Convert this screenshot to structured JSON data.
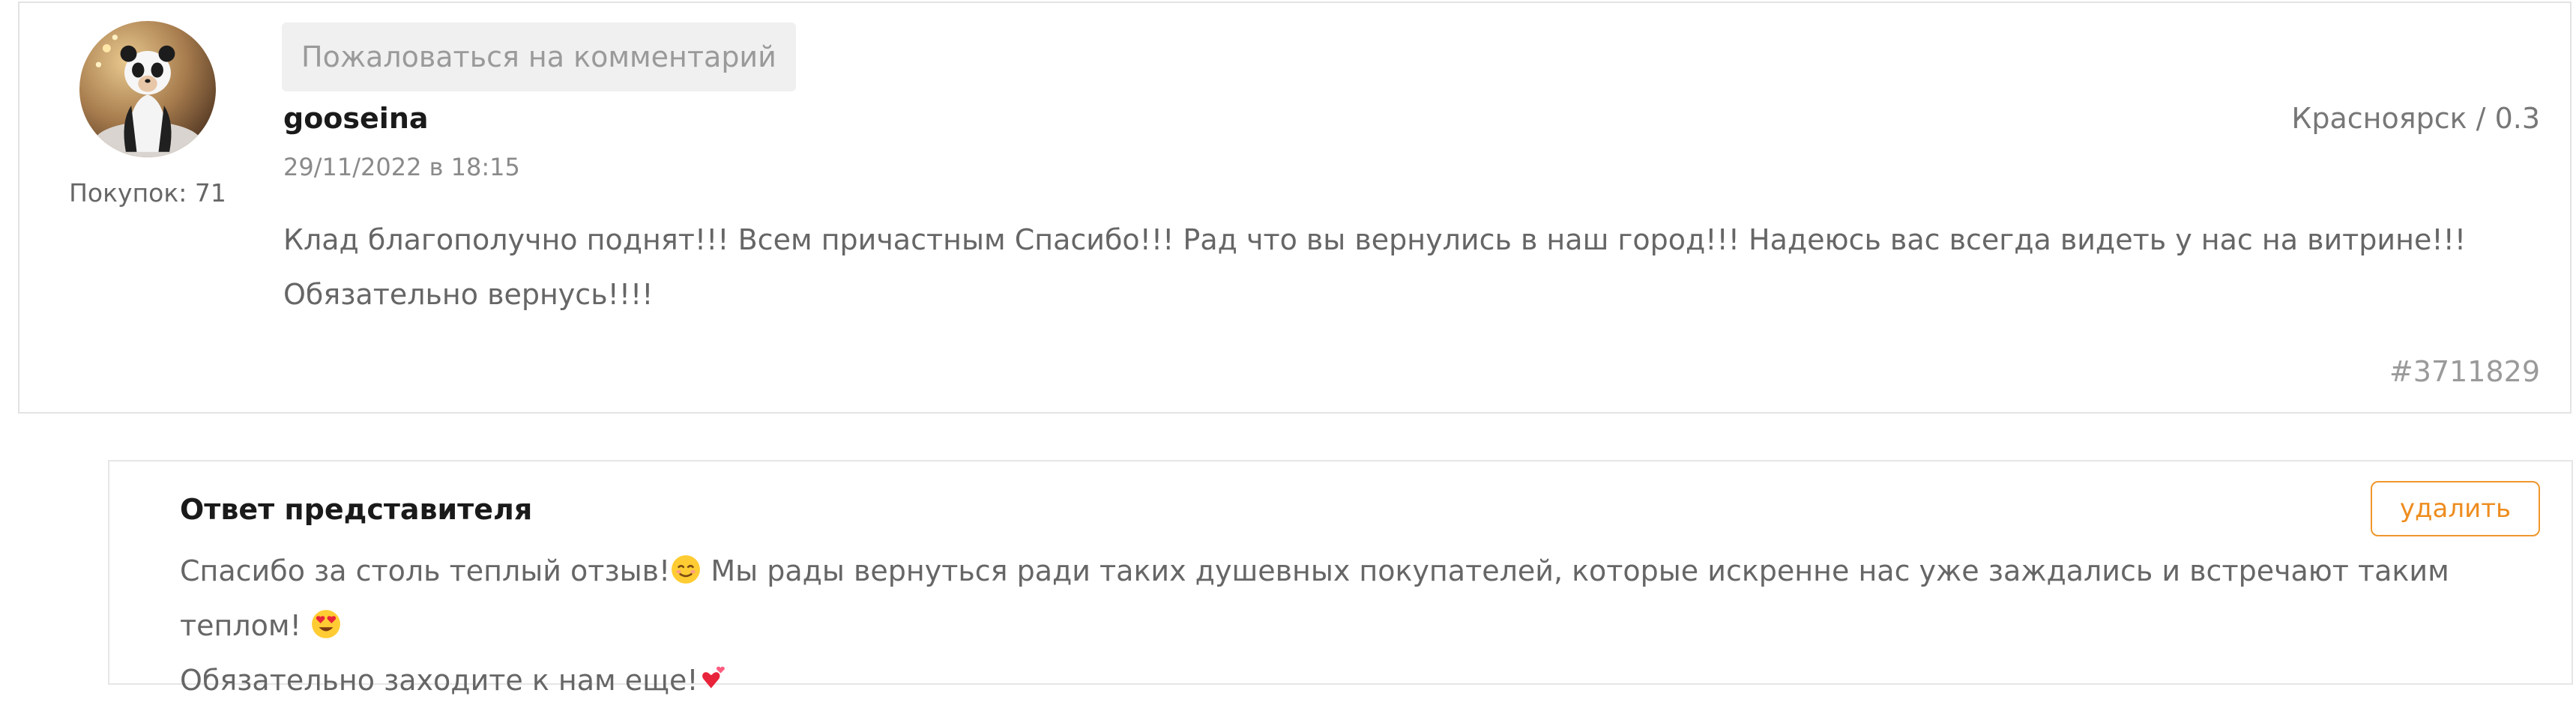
{
  "review": {
    "complain_label": "Пожаловаться на комментарий",
    "author": "gooseina",
    "location": "Красноярск / 0.3",
    "date": "29/11/2022 в 18:15",
    "purchases": "Покупок: 71",
    "text": "Клад благополучно поднят!!! Всем причастным Спасибо!!! Рад что вы вернулись в наш город!!! Надеюсь вас всегда видеть у нас на витрине!!! Обязательно вернусь!!!!",
    "id": "#3711829",
    "avatar_icon": "panda-costume-photo-avatar"
  },
  "reply": {
    "title": "Ответ представителя",
    "delete_label": "удалить",
    "text_part1": "Спасибо за столь теплый отзыв!",
    "text_part2": " Мы рады вернуться ради таких душевных покупателей, которые искренне нас уже заждались и встречают таким теплом! ",
    "text_part3": "Обязательно заходите к нам еще!",
    "emoji_1": "relieved-face-icon",
    "emoji_2": "heart-eyes-icon",
    "emoji_3": "revolving-hearts-icon"
  },
  "colors": {
    "accent_orange": "#ee8c1e",
    "text_gray": "#666666",
    "border": "#e3e3e3"
  }
}
